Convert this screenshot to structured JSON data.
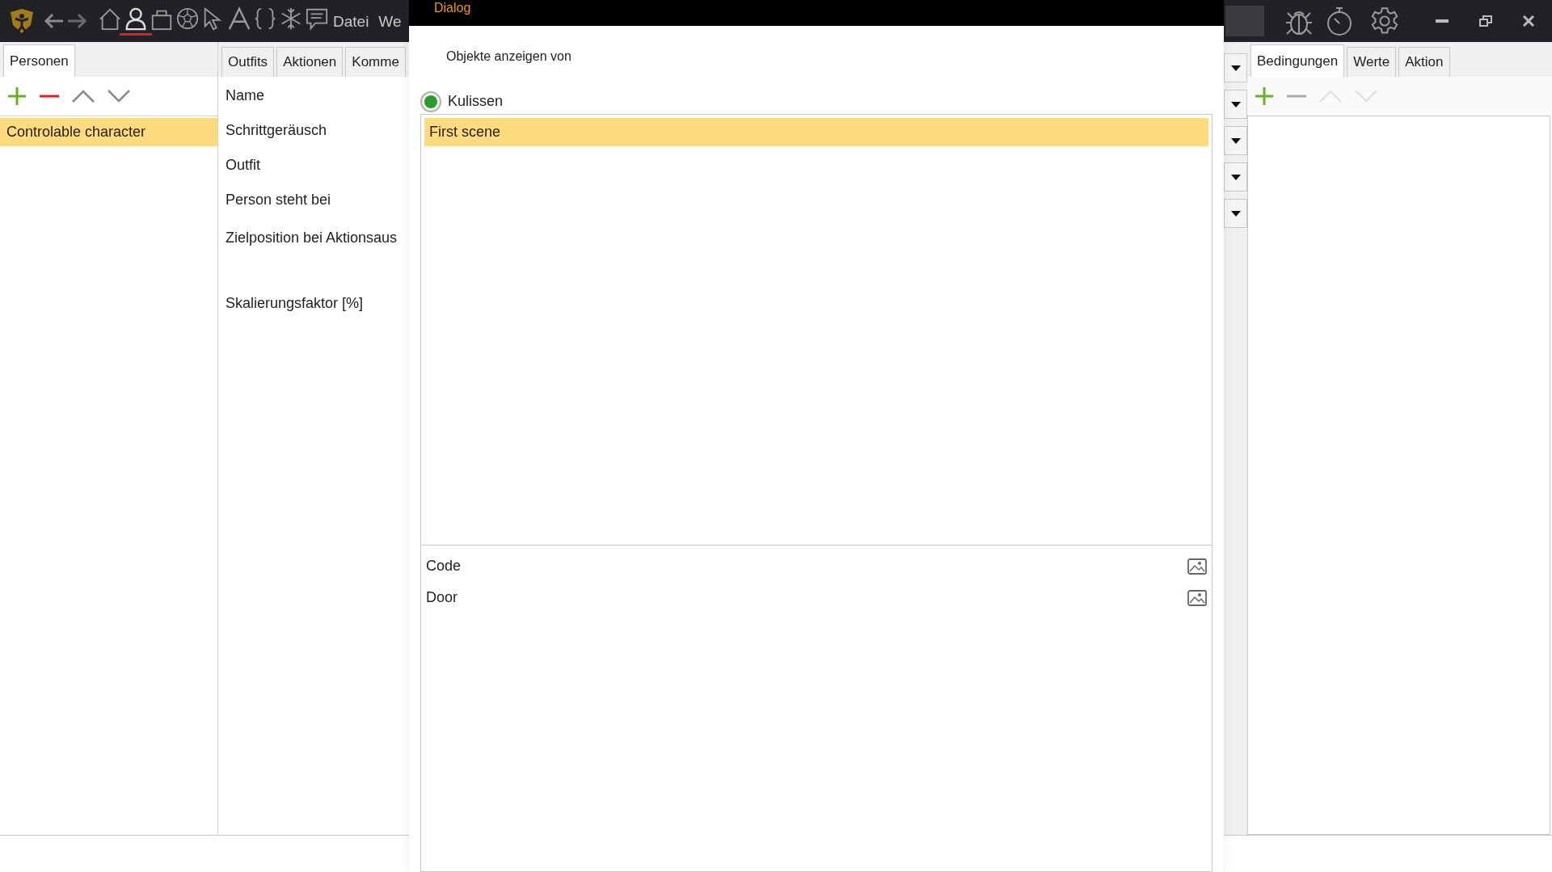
{
  "toolbar": {
    "tools": [
      {
        "kind": "home",
        "selected": false
      },
      {
        "kind": "person",
        "selected": true
      },
      {
        "kind": "bag",
        "selected": false
      },
      {
        "kind": "ball",
        "selected": false
      },
      {
        "kind": "cursor",
        "selected": false
      },
      {
        "kind": "font",
        "selected": false
      },
      {
        "kind": "braces",
        "selected": false
      },
      {
        "kind": "snowflake",
        "selected": false
      },
      {
        "kind": "comment",
        "selected": false
      }
    ],
    "menu": [
      "Datei",
      "We"
    ]
  },
  "left_panel": {
    "tabs": [
      {
        "label": "Personen",
        "selected": true
      }
    ],
    "actions": [
      {
        "kind": "add",
        "disabled": false
      },
      {
        "kind": "remove",
        "disabled": false
      },
      {
        "kind": "up",
        "disabled": false
      },
      {
        "kind": "down",
        "disabled": false
      }
    ],
    "items": [
      {
        "label": "Controlable character",
        "selected": true
      }
    ]
  },
  "middle_panel": {
    "tabs": [
      {
        "label": "Outfits",
        "selected": false
      },
      {
        "label": "Aktionen",
        "selected": false
      },
      {
        "label": "Komme",
        "selected": false
      }
    ],
    "fields": [
      "Name",
      "Schrittgeräusch",
      "Outfit",
      "Person steht bei",
      "Zielposition bei Aktionsaus",
      "Skalierungsfaktor [%]"
    ]
  },
  "dialog": {
    "title": "Dialog",
    "heading": "Objekte anzeigen von",
    "radio": {
      "label": "Kulissen",
      "selected": true
    },
    "scenes": [
      {
        "label": "First scene",
        "selected": true
      }
    ],
    "objects": [
      "Code",
      "Door"
    ]
  },
  "right_panel": {
    "tabs": [
      {
        "label": "Bedingungen",
        "selected": true
      },
      {
        "label": "Werte",
        "selected": false
      },
      {
        "label": "Aktion",
        "selected": false
      }
    ],
    "actions": [
      {
        "kind": "add",
        "disabled": false
      },
      {
        "kind": "remove",
        "disabled": true
      },
      {
        "kind": "up",
        "disabled": true
      },
      {
        "kind": "down",
        "disabled": true
      }
    ]
  }
}
